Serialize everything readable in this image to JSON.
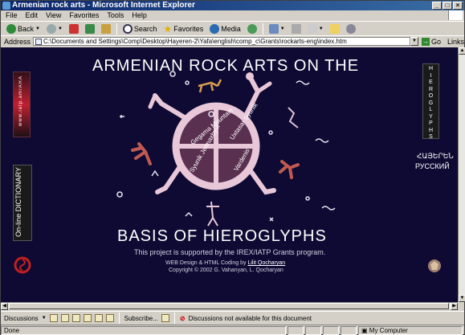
{
  "window": {
    "title": "Armenian rock arts - Microsoft Internet Explorer",
    "controls": [
      "_",
      "□",
      "×"
    ]
  },
  "menu": [
    "File",
    "Edit",
    "View",
    "Favorites",
    "Tools",
    "Help"
  ],
  "toolbar": {
    "back": "Back",
    "search": "Search",
    "favorites": "Favorites",
    "media": "Media"
  },
  "address": {
    "label": "Address",
    "url": "C:\\Documents and Settings\\Comp\\Desktop\\Hayeren-2\\Yafa\\english\\comp_c\\Grants\\rockarts-eng\\index.htm",
    "go": "Go",
    "links": "Links"
  },
  "page": {
    "title": "ARMENIAN ROCK ARTS ON THE",
    "subtitle": "BASIS OF HIEROGLYPHS",
    "support": "This project is supported by the IREX/IATP Grants program.",
    "credit_prefix": "WEB Design & HTML Coding by",
    "credit_name": "Lilit Qocharyan",
    "copyright": "Copyright © 2002 G. Vahanyan, L. Qocharyan",
    "side_url": "www.iatp.am/ARA",
    "dictionary": "On-line DICTIONARY",
    "hieroglyphs": "HIEROGLYPHS",
    "lang_armenian": "ՀԱՅԵՐԵՆ",
    "lang_russian": "РУССКИЙ",
    "wheel": {
      "q1": "Gegama Mountain",
      "q2": "Vardenis",
      "q3": "Syunik Jermaxbyur",
      "q4": "Uxtasar Syunik"
    }
  },
  "discussions": {
    "label": "Discussions",
    "subscribe": "Subscribe...",
    "message": "Discussions not available for this document"
  },
  "status": {
    "text": "Done",
    "zone": "My Computer"
  },
  "colors": {
    "page_bg": "#0f0a33",
    "figure": "#e8c8d8",
    "title_bar": "#0a246a"
  }
}
